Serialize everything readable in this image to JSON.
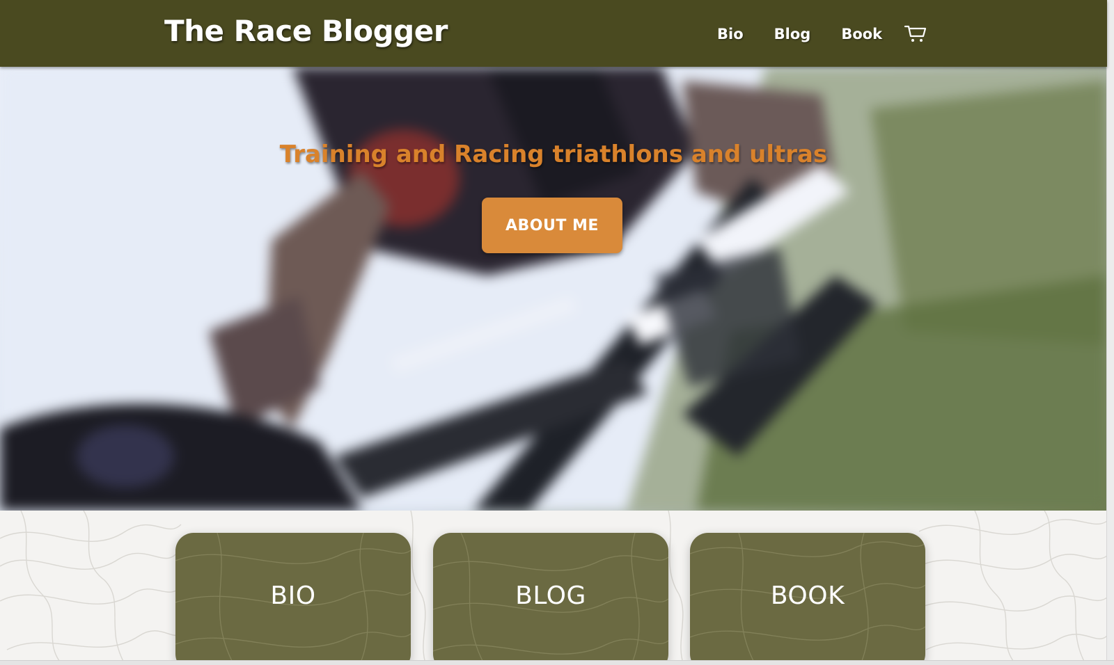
{
  "header": {
    "site_title": "The Race Blogger",
    "nav": [
      {
        "label": "Bio"
      },
      {
        "label": "Blog"
      },
      {
        "label": "Book"
      }
    ],
    "cart_icon": "shopping-cart-icon"
  },
  "hero": {
    "tagline": "Training and Racing triathlons and ultras",
    "button_label": "ABOUT ME",
    "image": "blurred-cyclist-photo"
  },
  "cards": [
    {
      "label": "BIO"
    },
    {
      "label": "BLOG"
    },
    {
      "label": "BOOK"
    }
  ],
  "colors": {
    "header_bg": "#4a4a20",
    "accent_orange": "#d9822b",
    "button_bg": "#d98a3a",
    "card_bg": "#6b6a42",
    "section_bg": "#f4f3f1"
  }
}
